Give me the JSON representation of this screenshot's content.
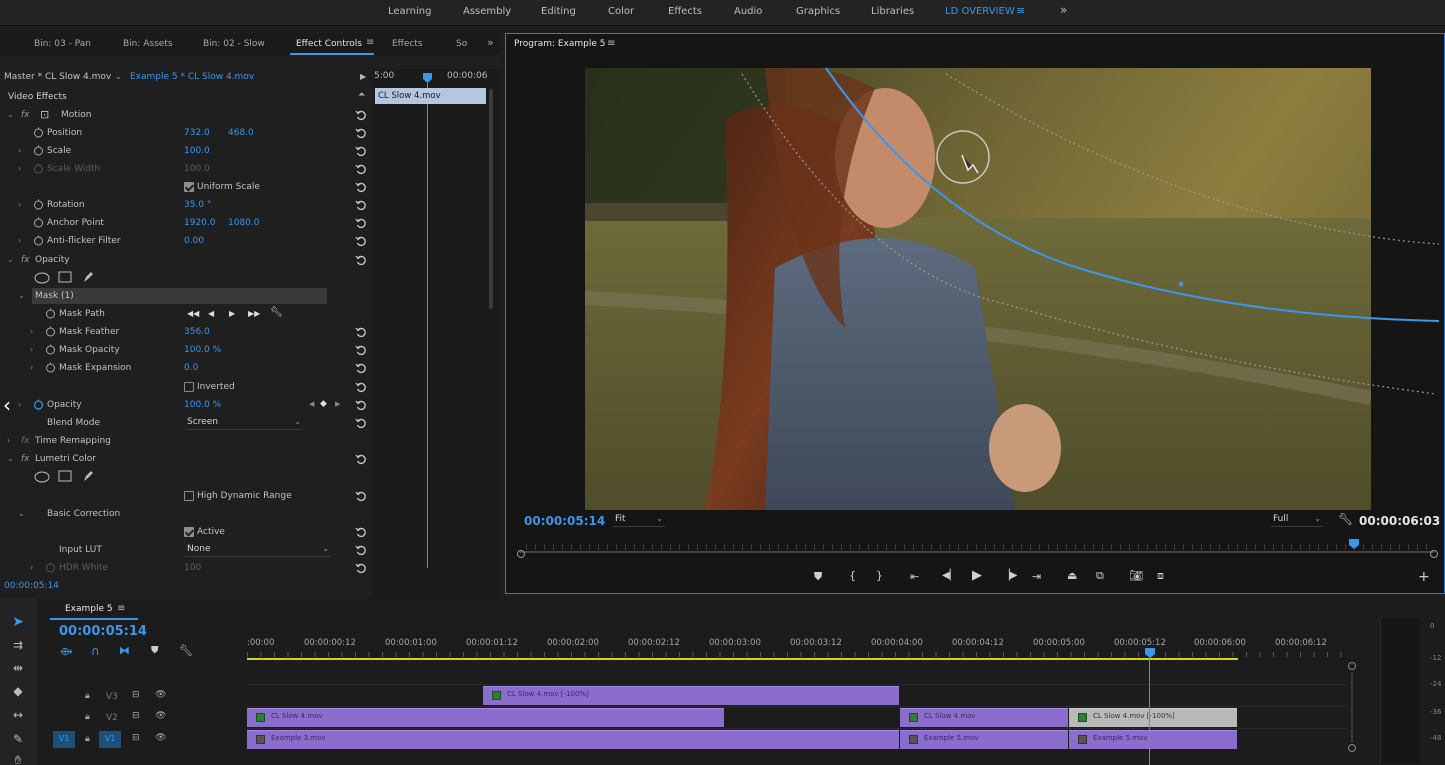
{
  "workspace_tabs": [
    "Learning",
    "Assembly",
    "Editing",
    "Color",
    "Effects",
    "Audio",
    "Graphics",
    "Libraries",
    "LD OVERVIEW"
  ],
  "workspace_more": "»",
  "panel_tabs": [
    "Bin: 03 - Pan",
    "Bin: Assets",
    "Bin: 02 - Slow",
    "Effect Controls",
    "Effects",
    "So"
  ],
  "panel_tabs_more": "»",
  "effect_controls": {
    "source_master": "Master * CL Slow 4.mov",
    "source_clip": "Example 5 * CL Slow 4.mov",
    "time_start": "5:00",
    "time_end": "00:00:06",
    "mini_clip": "CL Slow 4.mov",
    "section_title": "Video Effects",
    "motion": "Motion",
    "position_label": "Position",
    "position_x": "732.0",
    "position_y": "468.0",
    "scale_label": "Scale",
    "scale": "100.0",
    "scale_width_label": "Scale Width",
    "scale_width": "100.0",
    "uniform_scale": "Uniform Scale",
    "rotation_label": "Rotation",
    "rotation": "35.0 °",
    "anchor_label": "Anchor Point",
    "anchor_x": "1920.0",
    "anchor_y": "1080.0",
    "antiflicker_label": "Anti-flicker Filter",
    "antiflicker": "0.00",
    "opacity_fx": "Opacity",
    "mask_name": "Mask (1)",
    "mask_path": "Mask Path",
    "mask_feather_label": "Mask Feather",
    "mask_feather": "356.0",
    "mask_opacity_label": "Mask Opacity",
    "mask_opacity": "100.0 %",
    "mask_expansion_label": "Mask Expansion",
    "mask_expansion": "0.0",
    "inverted": "Inverted",
    "opacity_label": "Opacity",
    "opacity": "100.0 %",
    "blend_label": "Blend Mode",
    "blend": "Screen",
    "time_remap": "Time Remapping",
    "lumetri": "Lumetri Color",
    "hdr_range": "High Dynamic Range",
    "basic_correction": "Basic Correction",
    "active": "Active",
    "input_lut_label": "Input LUT",
    "input_lut": "None",
    "hdr_white_label": "HDR White",
    "hdr_white": "100",
    "current_time": "00:00:05:14"
  },
  "program": {
    "title": "Program: Example 5",
    "timecode": "00:00:05:14",
    "fit": "Fit",
    "resolution": "Full",
    "duration": "00:00:06:03"
  },
  "timeline": {
    "sequence": "Example 5",
    "timecode": "00:00:05:14",
    "ruler": [
      ":00:00",
      "00:00:00:12",
      "00:00:01:00",
      "00:00:01:12",
      "00:00:02:00",
      "00:00:02:12",
      "00:00:03:00",
      "00:00:03:12",
      "00:00:04:00",
      "00:00:04:12",
      "00:00:05:00",
      "00:00:05:12",
      "00:00:06:00",
      "00:00:06:12"
    ],
    "tracks": [
      "V3",
      "V2",
      "V1"
    ],
    "src_track": "V1",
    "clips": {
      "v3_a": "CL Slow 4.mov [-100%]",
      "v2_a": "CL Slow 4.mov",
      "v2_b": "CL Slow 4.mov",
      "v2_c": "CL Slow 4.mov [-100%]",
      "v1_a": "Example 3.mov",
      "v1_b": "Example 5.mov",
      "v1_c": "Example 5.mov"
    },
    "meter_labels": [
      "0",
      "-12",
      "-24",
      "-36",
      "-48"
    ]
  },
  "colors": {
    "accent": "#3d95ec",
    "clip": "#8a6dcc",
    "work_area": "#d6d11e"
  }
}
